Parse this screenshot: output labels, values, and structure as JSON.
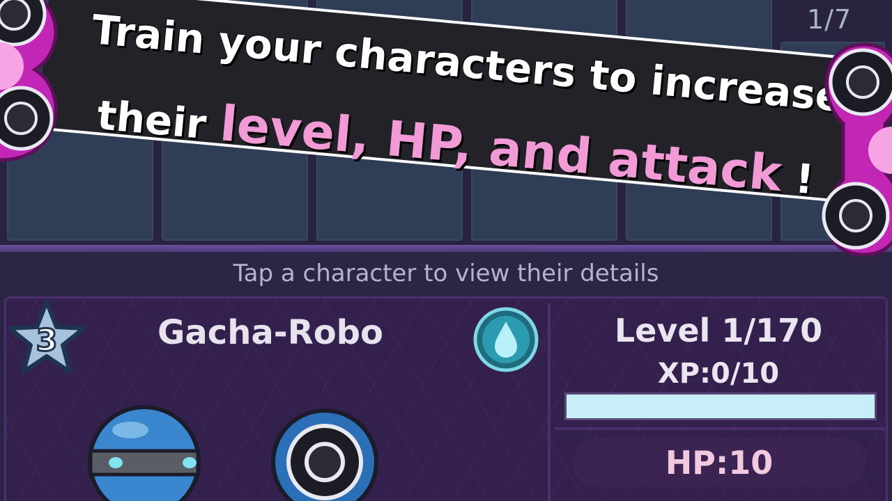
{
  "grid": {
    "page_indicator": "1/7"
  },
  "banner": {
    "line1": "Train your characters to increase",
    "line2_plain": "their ",
    "line2_highlight": "level, HP, and attack",
    "line2_end": " !"
  },
  "hint": "Tap a character to view their details",
  "character": {
    "stars": "3",
    "name": "Gacha-Robo",
    "element_icon": "water-drop-icon",
    "level": "Level 1/170",
    "xp": "XP:0/10",
    "xp_progress": 1.0,
    "hp": "HP:10"
  },
  "colors": {
    "banner_highlight": "#f19ad6",
    "spinner_magenta": "#c126b5",
    "xp_fill": "#c8eef7"
  }
}
